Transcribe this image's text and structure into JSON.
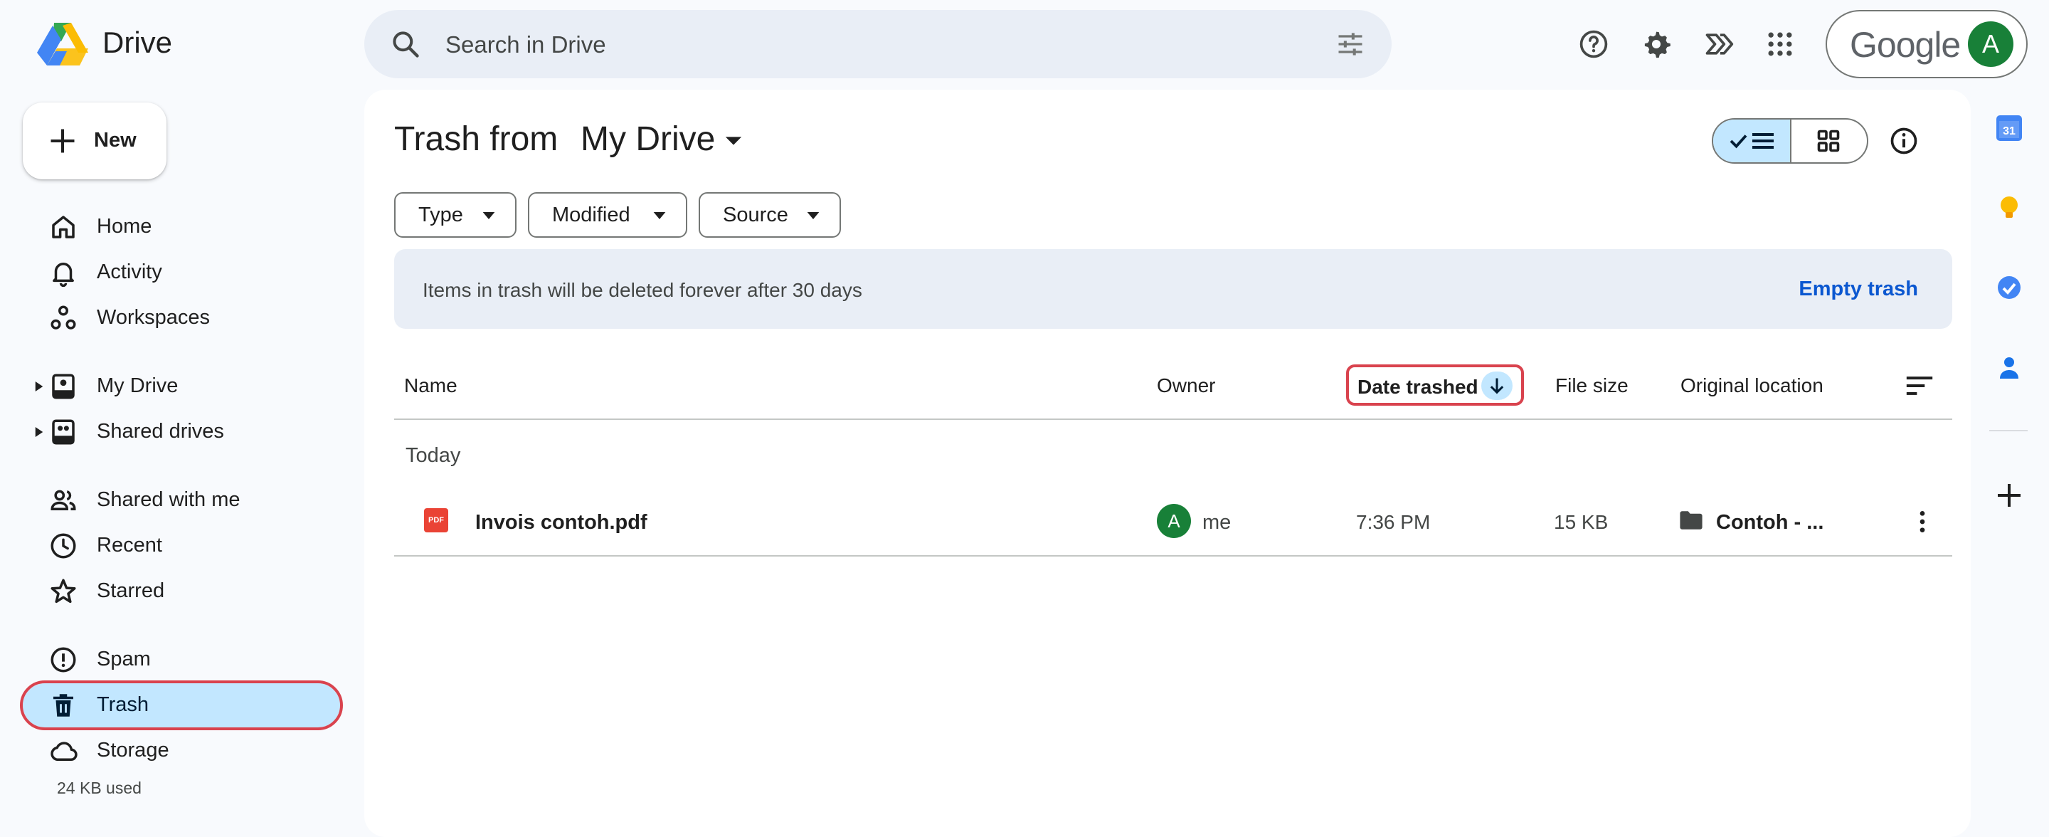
{
  "app": {
    "name": "Drive"
  },
  "search": {
    "placeholder": "Search in Drive"
  },
  "account": {
    "brand": "Google",
    "avatar_letter": "A",
    "avatar_color": "#188038"
  },
  "new_button": {
    "label": "New"
  },
  "sidebar": {
    "items": [
      {
        "label": "Home",
        "icon": "home-icon"
      },
      {
        "label": "Activity",
        "icon": "bell-icon"
      },
      {
        "label": "Workspaces",
        "icon": "workspaces-icon"
      },
      {
        "label": "My Drive",
        "icon": "my-drive-icon"
      },
      {
        "label": "Shared drives",
        "icon": "shared-drives-icon"
      },
      {
        "label": "Shared with me",
        "icon": "people-icon"
      },
      {
        "label": "Recent",
        "icon": "clock-icon"
      },
      {
        "label": "Starred",
        "icon": "star-icon"
      },
      {
        "label": "Spam",
        "icon": "spam-icon"
      },
      {
        "label": "Trash",
        "icon": "trash-icon",
        "active": true
      },
      {
        "label": "Storage",
        "icon": "cloud-icon"
      }
    ],
    "storage_used": "24 KB used"
  },
  "header": {
    "title_prefix": "Trash from",
    "title_location": "My Drive"
  },
  "filters": [
    {
      "label": "Type"
    },
    {
      "label": "Modified"
    },
    {
      "label": "Source"
    }
  ],
  "banner": {
    "text": "Items in trash will be deleted forever after 30 days",
    "action": "Empty trash"
  },
  "table": {
    "columns": {
      "name": "Name",
      "owner": "Owner",
      "date_trashed": "Date trashed",
      "file_size": "File size",
      "original_location": "Original location"
    },
    "group": "Today",
    "rows": [
      {
        "file_type_badge": "PDF",
        "name": "Invois contoh.pdf",
        "owner_initial": "A",
        "owner": "me",
        "date_trashed": "7:36 PM",
        "file_size": "15 KB",
        "original_location": "Contoh - ..."
      }
    ]
  },
  "side_panel": {
    "calendar_label": "31",
    "apps": [
      "calendar-icon",
      "keep-icon",
      "tasks-icon",
      "contacts-icon",
      "add-icon"
    ]
  },
  "colors": {
    "accent_blue": "#0b57d0",
    "selected_bg": "#c2e7ff",
    "highlight_red": "#d9434e",
    "surface": "#e9eef6"
  }
}
